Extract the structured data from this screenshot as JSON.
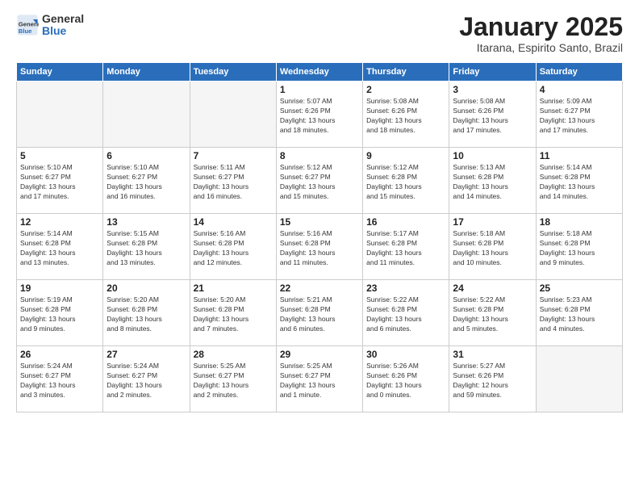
{
  "header": {
    "logo": {
      "general": "General",
      "blue": "Blue"
    },
    "title": "January 2025",
    "subtitle": "Itarana, Espirito Santo, Brazil"
  },
  "weekdays": [
    "Sunday",
    "Monday",
    "Tuesday",
    "Wednesday",
    "Thursday",
    "Friday",
    "Saturday"
  ],
  "weeks": [
    [
      {
        "day": "",
        "info": ""
      },
      {
        "day": "",
        "info": ""
      },
      {
        "day": "",
        "info": ""
      },
      {
        "day": "1",
        "info": "Sunrise: 5:07 AM\nSunset: 6:26 PM\nDaylight: 13 hours\nand 18 minutes."
      },
      {
        "day": "2",
        "info": "Sunrise: 5:08 AM\nSunset: 6:26 PM\nDaylight: 13 hours\nand 18 minutes."
      },
      {
        "day": "3",
        "info": "Sunrise: 5:08 AM\nSunset: 6:26 PM\nDaylight: 13 hours\nand 17 minutes."
      },
      {
        "day": "4",
        "info": "Sunrise: 5:09 AM\nSunset: 6:27 PM\nDaylight: 13 hours\nand 17 minutes."
      }
    ],
    [
      {
        "day": "5",
        "info": "Sunrise: 5:10 AM\nSunset: 6:27 PM\nDaylight: 13 hours\nand 17 minutes."
      },
      {
        "day": "6",
        "info": "Sunrise: 5:10 AM\nSunset: 6:27 PM\nDaylight: 13 hours\nand 16 minutes."
      },
      {
        "day": "7",
        "info": "Sunrise: 5:11 AM\nSunset: 6:27 PM\nDaylight: 13 hours\nand 16 minutes."
      },
      {
        "day": "8",
        "info": "Sunrise: 5:12 AM\nSunset: 6:27 PM\nDaylight: 13 hours\nand 15 minutes."
      },
      {
        "day": "9",
        "info": "Sunrise: 5:12 AM\nSunset: 6:28 PM\nDaylight: 13 hours\nand 15 minutes."
      },
      {
        "day": "10",
        "info": "Sunrise: 5:13 AM\nSunset: 6:28 PM\nDaylight: 13 hours\nand 14 minutes."
      },
      {
        "day": "11",
        "info": "Sunrise: 5:14 AM\nSunset: 6:28 PM\nDaylight: 13 hours\nand 14 minutes."
      }
    ],
    [
      {
        "day": "12",
        "info": "Sunrise: 5:14 AM\nSunset: 6:28 PM\nDaylight: 13 hours\nand 13 minutes."
      },
      {
        "day": "13",
        "info": "Sunrise: 5:15 AM\nSunset: 6:28 PM\nDaylight: 13 hours\nand 13 minutes."
      },
      {
        "day": "14",
        "info": "Sunrise: 5:16 AM\nSunset: 6:28 PM\nDaylight: 13 hours\nand 12 minutes."
      },
      {
        "day": "15",
        "info": "Sunrise: 5:16 AM\nSunset: 6:28 PM\nDaylight: 13 hours\nand 11 minutes."
      },
      {
        "day": "16",
        "info": "Sunrise: 5:17 AM\nSunset: 6:28 PM\nDaylight: 13 hours\nand 11 minutes."
      },
      {
        "day": "17",
        "info": "Sunrise: 5:18 AM\nSunset: 6:28 PM\nDaylight: 13 hours\nand 10 minutes."
      },
      {
        "day": "18",
        "info": "Sunrise: 5:18 AM\nSunset: 6:28 PM\nDaylight: 13 hours\nand 9 minutes."
      }
    ],
    [
      {
        "day": "19",
        "info": "Sunrise: 5:19 AM\nSunset: 6:28 PM\nDaylight: 13 hours\nand 9 minutes."
      },
      {
        "day": "20",
        "info": "Sunrise: 5:20 AM\nSunset: 6:28 PM\nDaylight: 13 hours\nand 8 minutes."
      },
      {
        "day": "21",
        "info": "Sunrise: 5:20 AM\nSunset: 6:28 PM\nDaylight: 13 hours\nand 7 minutes."
      },
      {
        "day": "22",
        "info": "Sunrise: 5:21 AM\nSunset: 6:28 PM\nDaylight: 13 hours\nand 6 minutes."
      },
      {
        "day": "23",
        "info": "Sunrise: 5:22 AM\nSunset: 6:28 PM\nDaylight: 13 hours\nand 6 minutes."
      },
      {
        "day": "24",
        "info": "Sunrise: 5:22 AM\nSunset: 6:28 PM\nDaylight: 13 hours\nand 5 minutes."
      },
      {
        "day": "25",
        "info": "Sunrise: 5:23 AM\nSunset: 6:28 PM\nDaylight: 13 hours\nand 4 minutes."
      }
    ],
    [
      {
        "day": "26",
        "info": "Sunrise: 5:24 AM\nSunset: 6:27 PM\nDaylight: 13 hours\nand 3 minutes."
      },
      {
        "day": "27",
        "info": "Sunrise: 5:24 AM\nSunset: 6:27 PM\nDaylight: 13 hours\nand 2 minutes."
      },
      {
        "day": "28",
        "info": "Sunrise: 5:25 AM\nSunset: 6:27 PM\nDaylight: 13 hours\nand 2 minutes."
      },
      {
        "day": "29",
        "info": "Sunrise: 5:25 AM\nSunset: 6:27 PM\nDaylight: 13 hours\nand 1 minute."
      },
      {
        "day": "30",
        "info": "Sunrise: 5:26 AM\nSunset: 6:26 PM\nDaylight: 13 hours\nand 0 minutes."
      },
      {
        "day": "31",
        "info": "Sunrise: 5:27 AM\nSunset: 6:26 PM\nDaylight: 12 hours\nand 59 minutes."
      },
      {
        "day": "",
        "info": ""
      }
    ]
  ]
}
